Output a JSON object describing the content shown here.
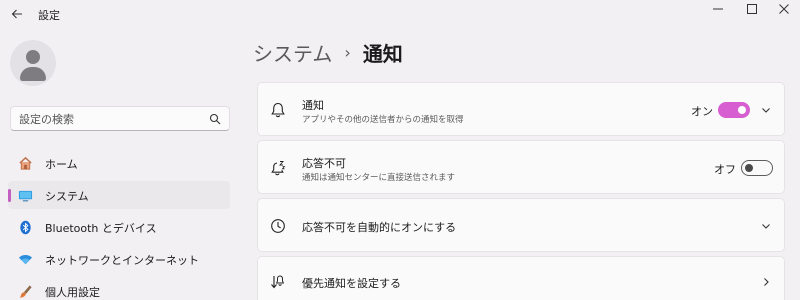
{
  "window": {
    "title": "設定"
  },
  "search": {
    "placeholder": "設定の検索"
  },
  "sidebar": {
    "items": [
      {
        "label": "ホーム",
        "icon": "home-icon"
      },
      {
        "label": "システム",
        "icon": "system-icon",
        "active": true
      },
      {
        "label": "Bluetooth とデバイス",
        "icon": "bluetooth-icon"
      },
      {
        "label": "ネットワークとインターネット",
        "icon": "wifi-icon"
      },
      {
        "label": "個人用設定",
        "icon": "brush-icon"
      }
    ]
  },
  "breadcrumb": {
    "parent": "システム",
    "separator": "›",
    "current": "通知"
  },
  "cards": [
    {
      "title": "通知",
      "description": "アプリやその他の送信者からの通知を取得",
      "icon": "bell-icon",
      "toggle_label": "オン",
      "toggle_on": true,
      "chevron": "down"
    },
    {
      "title": "応答不可",
      "description": "通知は通知センターに直接送信されます",
      "icon": "bell-snooze-icon",
      "toggle_label": "オフ",
      "toggle_on": false
    },
    {
      "title": "応答不可を自動的にオンにする",
      "icon": "clock-icon",
      "chevron": "down"
    },
    {
      "title": "優先通知を設定する",
      "icon": "priority-icon",
      "chevron": "right"
    }
  ],
  "colors": {
    "accent": "#d65ed1",
    "background": "#f3f0f4",
    "card": "#fbfafb"
  }
}
